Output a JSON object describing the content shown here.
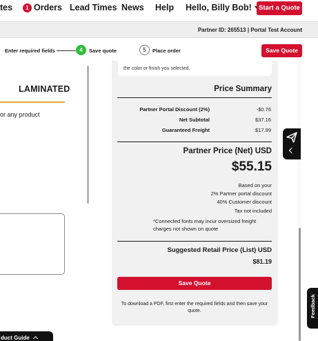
{
  "nav": {
    "quotes_partial": "tes",
    "orders_badge": "1",
    "orders": "Orders",
    "lead_times": "Lead Times",
    "news": "News",
    "help": "Help",
    "greeting": "Hello, Billy Bob!",
    "start_quote": "Start a Quote"
  },
  "partner_bar": {
    "text": "Partner ID: 265513 | Portal Test Account"
  },
  "steps": {
    "step1_label": "Enter required fields",
    "step2_number": "4",
    "step2_label": "Save quote",
    "step3_number": "5",
    "step3_label": "Place order",
    "save_quote": "Save Quote"
  },
  "left": {
    "section_title": "LAMINATED",
    "product_text": "or any product",
    "product_guide": "duct Guide"
  },
  "summary": {
    "notice": "the color or finish you selected.",
    "title": "Price Summary",
    "rows": [
      {
        "label": "Partner Portal Discount (2%)",
        "value": "-$0.76"
      },
      {
        "label": "Net Subtotal",
        "value": "$37.16"
      },
      {
        "label": "Guaranteed Freight",
        "value": "$17.99"
      }
    ],
    "partner_price_title": "Partner Price (Net) USD",
    "partner_price": "$55.15",
    "based_on": "Based on your",
    "discount_line1": "2% Partner portal discount",
    "discount_line2": "40% Customer discount",
    "tax_note": "Tax not included",
    "connected_note": "*Connected fonts may incur oversized freight charges not shown on quote",
    "srp_title": "Suggested Retail Price (List) USD",
    "srp_value": "$81.19",
    "save_quote": "Save Quote",
    "pdf_note": "To download a PDF, first enter the required fields and then save your quote."
  },
  "widgets": {
    "feedback": "Feedback",
    "send_icon": "paper-plane-icon",
    "collapse_icon": "chevron-left-icon"
  },
  "colors": {
    "brand_red": "#d3112f",
    "step_active_green": "#2fbf3b",
    "underline_gold": "#e5a823"
  }
}
